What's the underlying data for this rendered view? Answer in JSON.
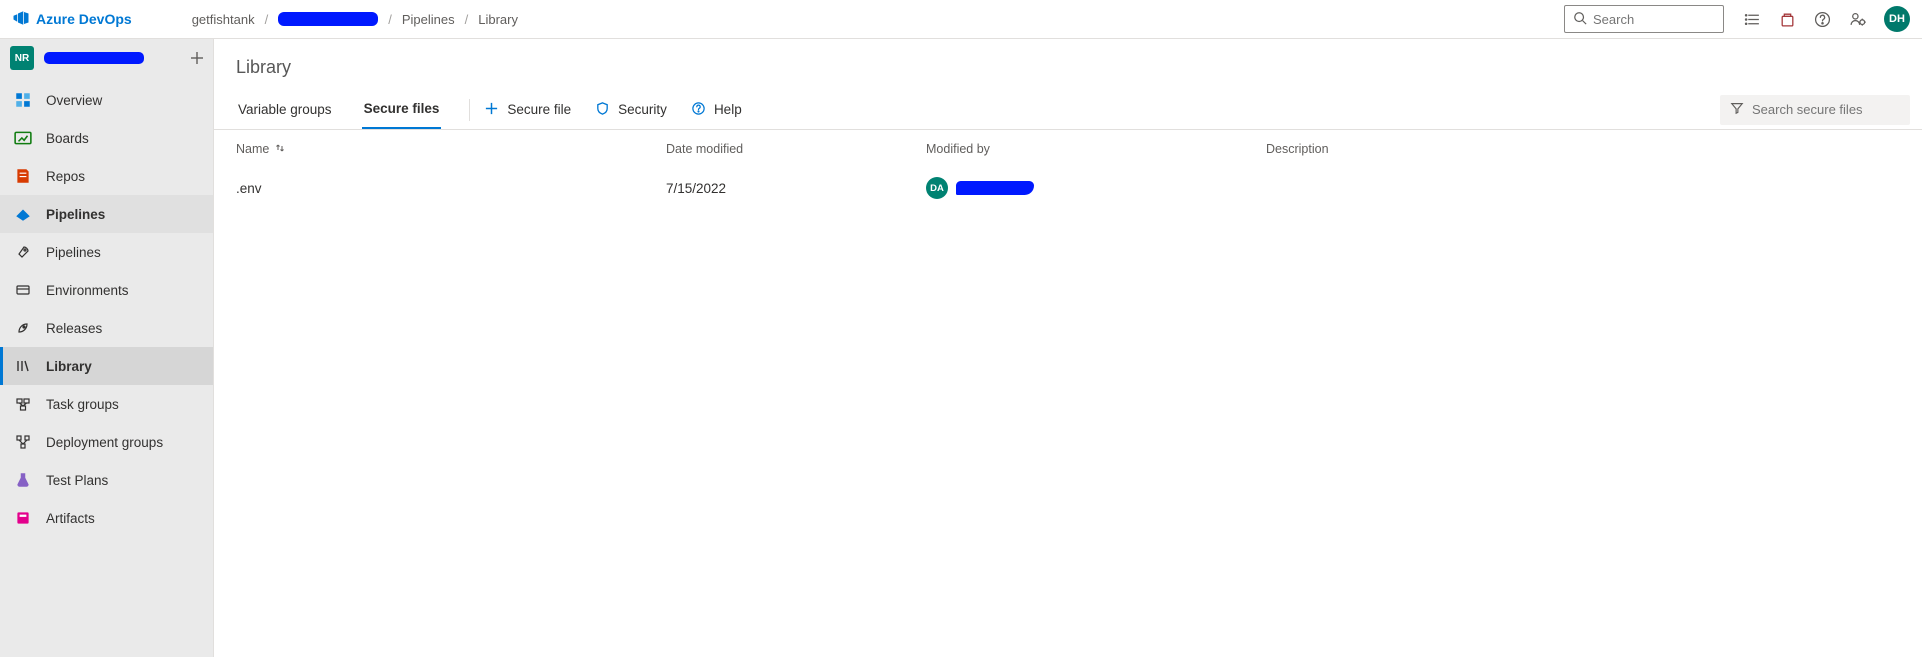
{
  "brand": "Azure DevOps",
  "breadcrumb": {
    "org": "getfishtank",
    "project": "",
    "area": "Pipelines",
    "page": "Library"
  },
  "search_placeholder": "Search",
  "top_avatar": "DH",
  "project_avatar": "NR",
  "sidebar": {
    "items": [
      {
        "label": "Overview"
      },
      {
        "label": "Boards"
      },
      {
        "label": "Repos"
      },
      {
        "label": "Pipelines"
      },
      {
        "label": "Pipelines"
      },
      {
        "label": "Environments"
      },
      {
        "label": "Releases"
      },
      {
        "label": "Library"
      },
      {
        "label": "Task groups"
      },
      {
        "label": "Deployment groups"
      },
      {
        "label": "Test Plans"
      },
      {
        "label": "Artifacts"
      }
    ]
  },
  "page_title": "Library",
  "tabs": {
    "variable_groups": "Variable groups",
    "secure_files": "Secure files",
    "add_secure_file": "Secure file",
    "security": "Security",
    "help": "Help"
  },
  "filter_placeholder": "Search secure files",
  "columns": {
    "name": "Name",
    "date_modified": "Date modified",
    "modified_by": "Modified by",
    "description": "Description"
  },
  "rows": [
    {
      "name": ".env",
      "date_modified": "7/15/2022",
      "modified_by_initials": "DA",
      "modified_by": "",
      "description": ""
    }
  ]
}
